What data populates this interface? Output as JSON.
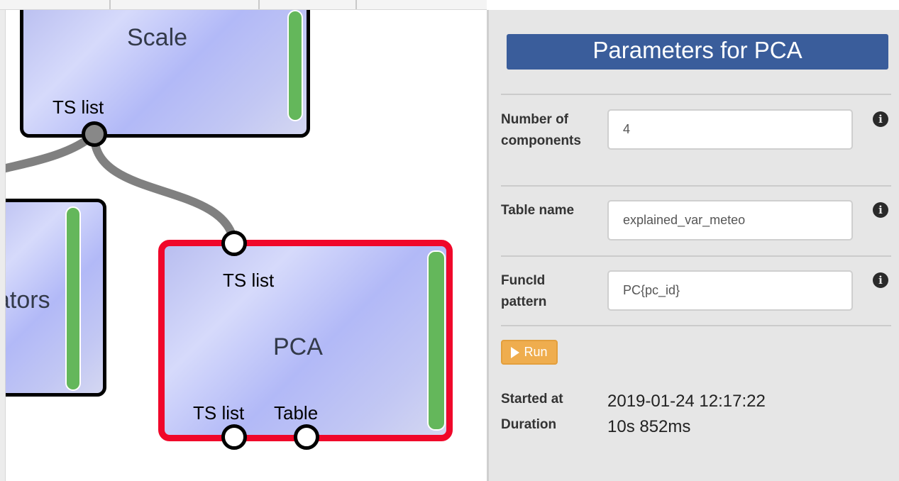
{
  "canvas": {
    "nodes": [
      {
        "title": "Scale",
        "port_out": "TS list"
      },
      {
        "title": "ators"
      },
      {
        "title": "PCA",
        "port_in": "TS list",
        "port_out_1": "TS list",
        "port_out_2": "Table"
      }
    ]
  },
  "panel": {
    "title": "Parameters for PCA",
    "params": [
      {
        "label": "Number of components",
        "value": "4",
        "info_icon": "info-icon"
      },
      {
        "label": "Table name",
        "value": "explained_var_meteo",
        "info_icon": "info-icon"
      },
      {
        "label": "FuncId pattern",
        "value": "PC{pc_id}",
        "info_icon": "info-icon"
      }
    ],
    "run_label": "Run",
    "status": {
      "started_label": "Started at",
      "started_value": "2019-01-24 12:17:22",
      "duration_label": "Duration",
      "duration_value": "10s 852ms"
    }
  },
  "colors": {
    "node_border_selected": "#f0072a",
    "node_bar": "#64b75b",
    "panel_title_bg": "#3a5d9b",
    "run_button": "#efad4e"
  }
}
